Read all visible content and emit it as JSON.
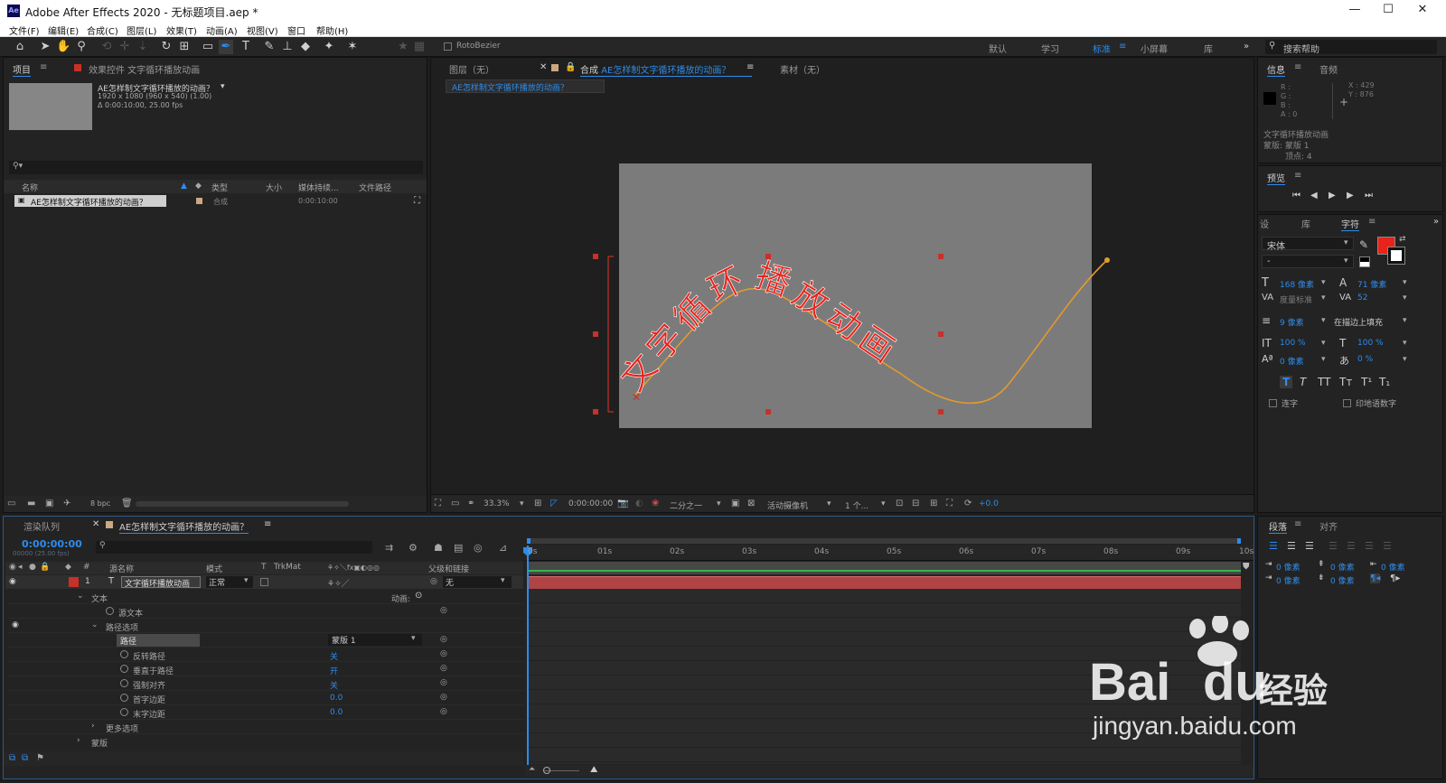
{
  "window": {
    "logo": "Ae",
    "title": "Adobe After Effects 2020 - 无标题项目.aep *",
    "controls": [
      "—",
      "☐",
      "✕"
    ]
  },
  "menu": [
    "文件(F)",
    "编辑(E)",
    "合成(C)",
    "图层(L)",
    "效果(T)",
    "动画(A)",
    "视图(V)",
    "窗口",
    "帮助(H)"
  ],
  "toolbar": {
    "rotobezier": "RotoBezier",
    "workspaces": [
      "默认",
      "学习",
      "标准",
      "小屏幕",
      "库"
    ],
    "active_workspace": "标准",
    "search_placeholder": "搜索帮助"
  },
  "project_panel": {
    "tab_project": "项目",
    "tab_effects": "效果控件 文字循环播放动画",
    "comp_name": "AE怎样制文字循环播放的动画？",
    "comp_info_1": "1920 x 1080  (960 x 540) (1.00)",
    "comp_info_2": "Δ 0:00:10:00, 25.00 fps",
    "columns": [
      "名称",
      "类型",
      "大小",
      "媒体持续...",
      "文件路径"
    ],
    "item_name": "AE怎样制文字循环播放的动画？",
    "item_type": "合成",
    "item_duration": "0:00:10:00",
    "bpc": "8 bpc"
  },
  "viewer": {
    "tab_layer": "图层（无）",
    "tab_comp_prefix": "合成",
    "tab_comp_name": "AE怎样制文字循环播放的动画？",
    "tab_footage": "素材（无）",
    "breadcrumb": "AE怎样制文字循环播放的动画？",
    "path_text": "文字循环播放动画",
    "zoom": "33.3%",
    "timecode": "0:00:00:00",
    "resolution": "二分之一",
    "camera": "活动摄像机",
    "views": "1 个...",
    "exposure": "+0.0"
  },
  "info_panel": {
    "tab_info": "信息",
    "tab_audio": "音频",
    "r": "R :",
    "g": "G :",
    "b": "B :",
    "a": "A : 0",
    "x": "X : 429",
    "y": "Y : 876",
    "line1": "文字循环播放动画",
    "line2": "蒙版: 蒙版 1",
    "line3": "顶点: 4"
  },
  "preview_panel": {
    "title": "预览"
  },
  "character_panel": {
    "tab_settings": "设",
    "tab_library": "库",
    "tab_character": "字符",
    "font": "宋体",
    "style": "-",
    "size": "168 像素",
    "leading": "71 像素",
    "kerning": "度量标准",
    "tracking": "52",
    "stroke_width": "9 像素",
    "stroke_mode": "在描边上填充",
    "vscale": "100 %",
    "hscale": "100 %",
    "baseline": "0 像素",
    "tsume": "0 %",
    "styles": [
      "T",
      "T",
      "TT",
      "Tт",
      "T¹",
      "T₁"
    ],
    "ligature": "连字",
    "hindi_digits": "印地语数字",
    "fill_color": "#e8231b",
    "stroke_color": "#ffffff"
  },
  "timeline": {
    "tab_render": "渲染队列",
    "tab_comp": "AE怎样制文字循环播放的动画？",
    "timecode": "0:00:00:00",
    "frame_info": "00000 (25.00 fps)",
    "columns": {
      "num": "#",
      "source": "源名称",
      "mode": "模式",
      "t": "T",
      "trkmat": "TrkMat",
      "parent": "父级和链接"
    },
    "ticks": [
      "0s",
      "01s",
      "02s",
      "03s",
      "04s",
      "05s",
      "06s",
      "07s",
      "08s",
      "09s",
      "10s"
    ],
    "layer": {
      "num": "1",
      "type": "T",
      "name": "文字循环播放动画",
      "mode": "正常",
      "parent": "无"
    },
    "props": {
      "text": "文本",
      "animate": "动画:",
      "source_text": "源文本",
      "path_options": "路径选项",
      "path": "路径",
      "path_value": "蒙版 1",
      "reverse": "反转路径",
      "reverse_val": "关",
      "perpendicular": "垂直于路径",
      "perpendicular_val": "开",
      "force_align": "强制对齐",
      "force_align_val": "关",
      "first_margin": "首字边距",
      "first_margin_val": "0.0",
      "last_margin": "末字边距",
      "last_margin_val": "0.0",
      "more_options": "更多选项",
      "masks": "蒙版"
    }
  },
  "paragraph_panel": {
    "tab_paragraph": "段落",
    "tab_align": "对齐",
    "values": [
      "0 像素",
      "0 像素",
      "0 像素",
      "0 像素",
      "0 像素"
    ]
  },
  "watermark": {
    "brand": "Bai",
    "brand2": "du",
    "jingyan": "经验",
    "url": "jingyan.baidu.com"
  }
}
